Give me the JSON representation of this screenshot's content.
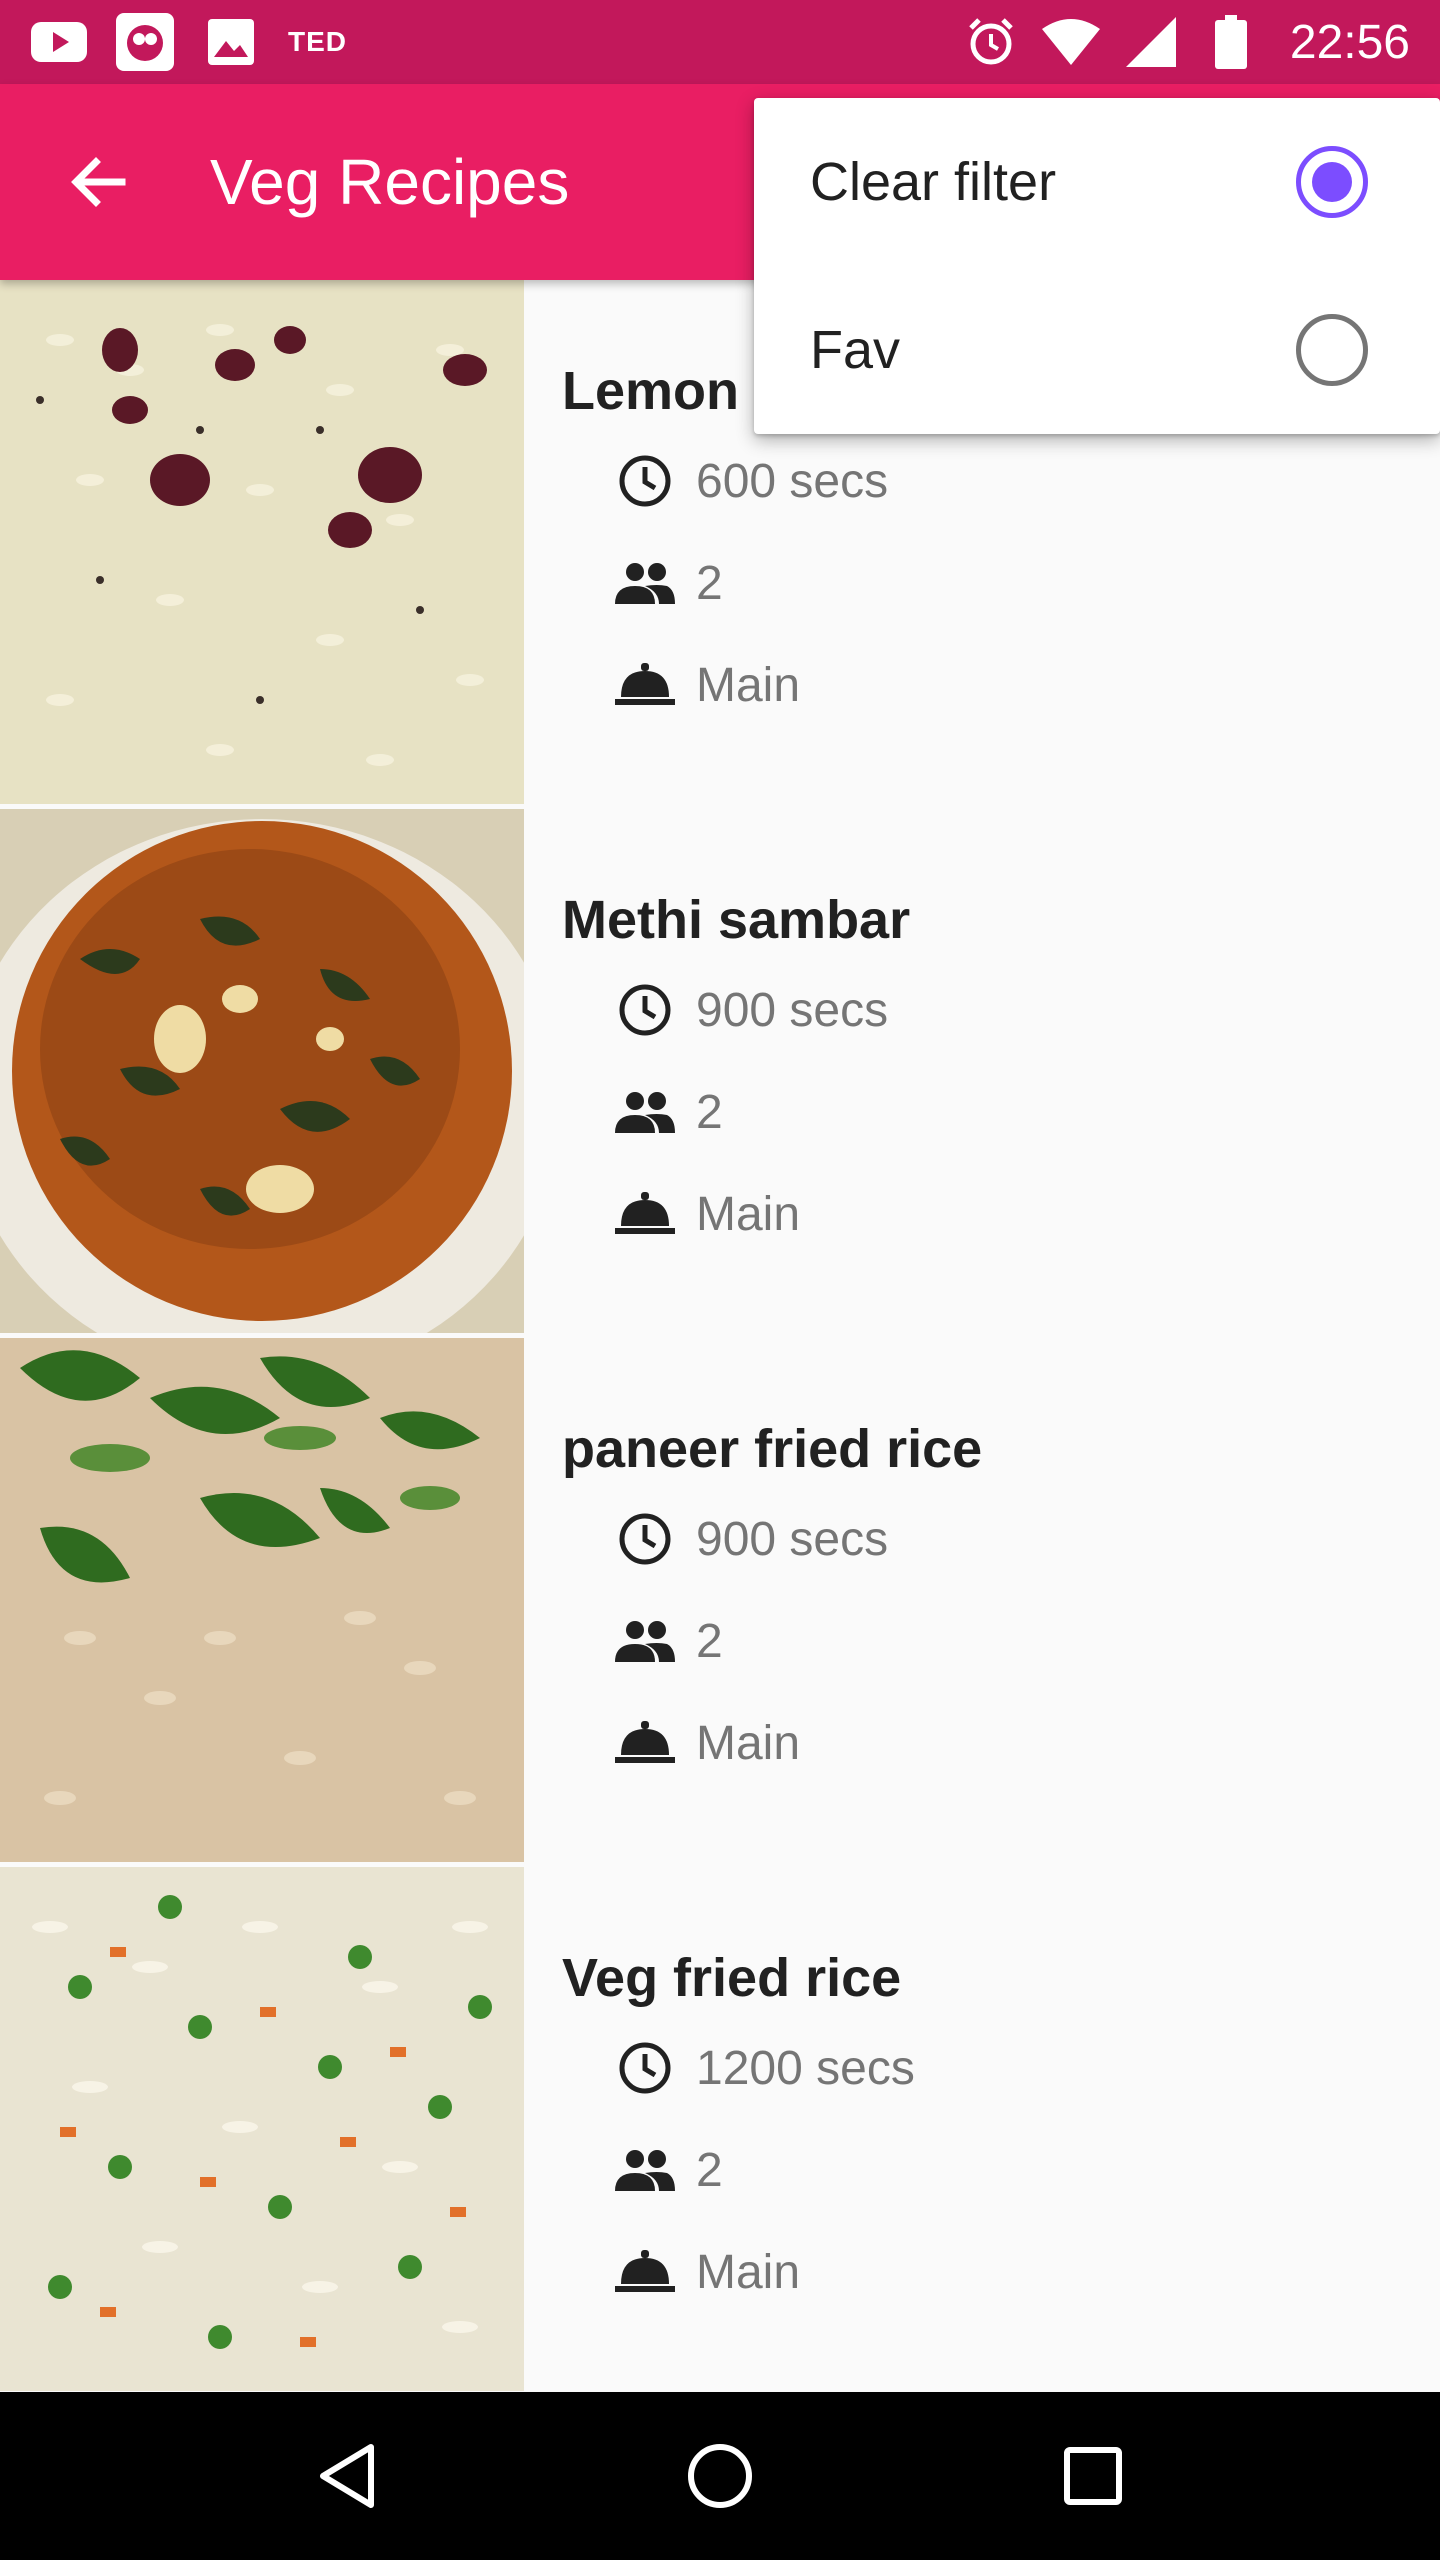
{
  "status_bar": {
    "notification_icons": [
      "youtube-icon",
      "app-notification-icon",
      "image-icon"
    ],
    "ted_label": "TED",
    "system_icons": [
      "alarm-icon",
      "wifi-icon",
      "signal-icon",
      "battery-icon"
    ],
    "time": "22:56"
  },
  "app_bar": {
    "title": "Veg Recipes",
    "back_icon": "arrow-back-icon",
    "background": "#e91e63"
  },
  "popup_menu": {
    "items": [
      {
        "label": "Clear filter",
        "selected": true
      },
      {
        "label": "Fav",
        "selected": false
      }
    ],
    "accent": "#7c4dff"
  },
  "recipes": [
    {
      "name": "Lemon Rice",
      "visible_name": "Lemon I",
      "time": "600 secs",
      "servings": "2",
      "course": "Main"
    },
    {
      "name": "Methi sambar",
      "visible_name": "Methi sambar",
      "time": "900 secs",
      "servings": "2",
      "course": "Main"
    },
    {
      "name": "paneer fried rice",
      "visible_name": "paneer fried rice",
      "time": "900 secs",
      "servings": "2",
      "course": "Main"
    },
    {
      "name": "Veg fried rice",
      "visible_name": "Veg fried rice",
      "time": "1200 secs",
      "servings": "2",
      "course": "Main"
    }
  ],
  "meta_icons": {
    "time": "clock-icon",
    "servings": "people-icon",
    "course": "dish-icon"
  },
  "nav_bar": {
    "buttons": [
      "back-triangle-icon",
      "home-circle-icon",
      "recents-square-icon"
    ]
  }
}
